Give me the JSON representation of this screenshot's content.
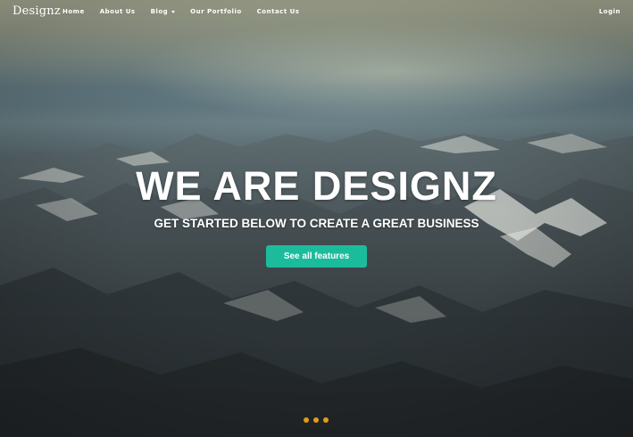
{
  "brand": {
    "name": "Designz"
  },
  "nav": {
    "items": [
      {
        "label": "Home"
      },
      {
        "label": "About Us"
      },
      {
        "label": "Blog"
      },
      {
        "label": "Our Portfolio"
      },
      {
        "label": "Contact Us"
      }
    ],
    "login_label": "Login"
  },
  "hero": {
    "headline": "WE ARE DESIGNZ",
    "subheadline": "GET STARTED BELOW TO CREATE A GREAT BUSINESS",
    "cta_label": "See all features",
    "cta_color": "#1bbc9b",
    "background_image": "aerial view of snow-capped mountain range"
  },
  "carousel": {
    "slide_count": 3,
    "dot_color": "#e09b1d"
  }
}
